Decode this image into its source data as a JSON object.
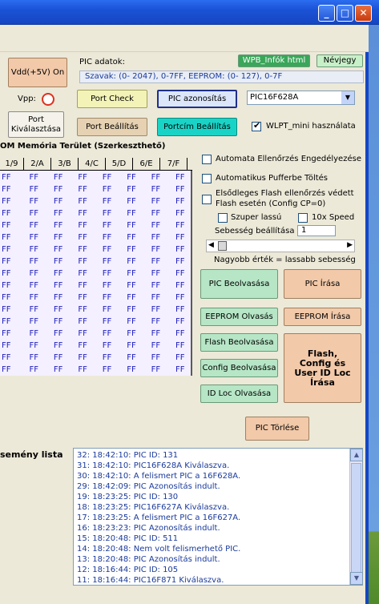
{
  "pic_info": {
    "label": "PIC adatok:",
    "summary": "Szavak: (0- 2047),  0-7FF,   EEPROM: (0- 127),  0-7F"
  },
  "buttons": {
    "vdd": "Vdd(+5V) On",
    "port_select": "Port Kiválasztása",
    "port_check": "Port Check",
    "pic_id": "PIC azonosítás",
    "port_settings": "Port Beállítás",
    "port_addr_settings": "Portcím Beállítás",
    "wpb_info": "WPB_Infók html",
    "about": "Névjegy",
    "pic_read": "PIC Beolvasása",
    "pic_write": "PIC   Írása",
    "eeprom_read": "EEPROM Olvasás",
    "eeprom_write": "EEPROM Írása",
    "flash_read": "Flash Beolvasása",
    "config_read": "Config Beolvasása",
    "idloc_read": "ID Loc Olvasása",
    "flash_write": "Flash, Config és User ID Loc Írása",
    "pic_erase": "PIC  Törlése"
  },
  "vpp_label": "Vpp:",
  "device_select": {
    "value": "PIC16F628A"
  },
  "wlpt_label": "WLPT_mini használata",
  "grid": {
    "title": "OM Memória Terület (Szerkeszthető)",
    "headers": [
      "1/9",
      "2/A",
      "3/B",
      "4/C",
      "5/D",
      "6/E",
      "7/F"
    ],
    "cell": "FF",
    "row_count": 17
  },
  "options": {
    "auto_verify": "Automata Ellenőrzés Engedélyezése",
    "auto_buffer": "Automatikus Pufferbe Töltés",
    "flash_verify_line1": "Elsődleges Flash ellenőrzés védett",
    "flash_verify_line2": "Flash esetén (Config CP=0)",
    "super_slow": "Szuper lassú",
    "speed_10x": "10x Speed",
    "speed_label": "Sebesség beállítása :",
    "speed_value": "1",
    "speed_hint": "Nagyobb érték = lassabb sebesség"
  },
  "event_list": {
    "title": "semény lista",
    "items": [
      "32:  18:42:10:  PIC ID: 131",
      "31:  18:42:10:  PIC16F628A Kiválaszva.",
      "30:  18:42:10:  A felismert PIC a 16F628A.",
      "29:  18:42:09:  PIC Azonosítás indult.",
      "19:  18:23:25:  PIC ID: 130",
      "18:  18:23:25:  PIC16F627A Kiválaszva.",
      "17:  18:23:25:  A felismert PIC a 16F627A.",
      "16:  18:23:23:  PIC Azonosítás indult.",
      "15:  18:20:48:  PIC ID: 511",
      "14:  18:20:48:  Nem volt felismerhető PIC.",
      "13:  18:20:48:  PIC Azonosítás indult.",
      "12:  18:16:44:  PIC ID: 105",
      "11:  18:16:44:  PIC16F871 Kiválaszva."
    ]
  },
  "colors": {
    "titlebar": "#1b52d6",
    "window": "#ece9d8",
    "list_text": "#1a3a9a"
  }
}
